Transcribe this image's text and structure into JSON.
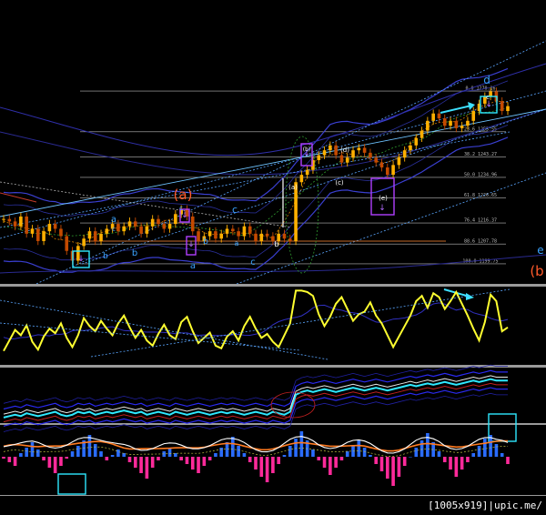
{
  "chart_data": [
    {
      "type": "line",
      "panel": "price",
      "fib_levels": [
        "0.0  1270.16",
        "23.6  1253.55",
        "38.2  1243.27",
        "50.0  1234.96",
        "61.8  1226.65",
        "76.4  1216.37",
        "88.6  1207.78",
        "100.0  1199.75"
      ],
      "wave_labels": [
        {
          "text": "a",
          "color": "#3aa3ff"
        },
        {
          "text": "b",
          "color": "#3aa3ff"
        },
        {
          "text": "c",
          "color": "#3aa3ff"
        },
        {
          "text": "b",
          "color": "#3aa3ff"
        },
        {
          "text": "(a)",
          "color": "#ff5a2a"
        },
        {
          "text": "c",
          "color": "#3aa3ff"
        },
        {
          "text": "a",
          "color": "#3aa3ff"
        },
        {
          "text": "b",
          "color": "#3aa3ff"
        },
        {
          "text": "c",
          "color": "#3aa3ff"
        },
        {
          "text": "a",
          "color": "#3aa3ff"
        },
        {
          "text": "c",
          "color": "#3aa3ff"
        },
        {
          "text": "b",
          "color": "#ffffff"
        },
        {
          "text": "(a)",
          "color": "#ffffff"
        },
        {
          "text": "(b)",
          "color": "#ffffff"
        },
        {
          "text": "(c)",
          "color": "#ffffff"
        },
        {
          "text": "(d)",
          "color": "#ffffff"
        },
        {
          "text": "(e)",
          "color": "#ffffff"
        },
        {
          "text": "c",
          "color": "#ffffff"
        },
        {
          "text": "d",
          "color": "#3aa3ff"
        },
        {
          "text": "e",
          "color": "#3aa3ff"
        },
        {
          "text": "(b",
          "color": "#ff5a2a"
        }
      ],
      "series": [
        {
          "values": [
            1218,
            1217,
            1215,
            1219,
            1212,
            1214,
            1209,
            1213,
            1216,
            1214,
            1211,
            1205,
            1201,
            1207,
            1210,
            1213,
            1209,
            1212,
            1214,
            1216,
            1213,
            1215,
            1217,
            1215,
            1212,
            1215,
            1218,
            1216,
            1214,
            1216,
            1220,
            1222,
            1219,
            1213,
            1209,
            1211,
            1213,
            1210,
            1212,
            1214,
            1213,
            1211,
            1215,
            1212,
            1209,
            1212,
            1211,
            1209,
            1212,
            1210,
            1209,
            1233,
            1236,
            1238,
            1242,
            1244,
            1246,
            1248,
            1244,
            1241,
            1243,
            1246,
            1247,
            1245,
            1243,
            1241,
            1239,
            1236,
            1240,
            1243,
            1246,
            1248,
            1251,
            1254,
            1258,
            1261,
            1259,
            1256,
            1258,
            1255,
            1256,
            1258,
            1262,
            1265,
            1268,
            1270,
            1266,
            1262,
            1264
          ]
        }
      ]
    },
    {
      "type": "line",
      "panel": "oscillator",
      "series": [
        {
          "values": [
            6,
            22,
            38,
            30,
            45,
            20,
            8,
            28,
            40,
            33,
            48,
            26,
            12,
            30,
            56,
            44,
            36,
            52,
            40,
            30,
            48,
            60,
            42,
            26,
            38,
            22,
            14,
            32,
            46,
            30,
            24,
            50,
            58,
            36,
            18,
            26,
            34,
            14,
            10,
            28,
            36,
            22,
            44,
            58,
            40,
            26,
            32,
            20,
            12,
            30,
            48,
            98,
            98,
            96,
            90,
            62,
            44,
            58,
            78,
            88,
            70,
            52,
            62,
            66,
            80,
            60,
            48,
            30,
            12,
            28,
            44,
            60,
            82,
            90,
            72,
            94,
            88,
            70,
            82,
            96,
            78,
            60,
            40,
            22,
            50,
            92,
            82,
            36,
            42
          ]
        }
      ]
    },
    {
      "type": "line",
      "panel": "moving-averages",
      "series": [
        {
          "values": [
            1,
            1.5,
            2,
            1.5,
            2.5,
            2,
            1.5,
            2,
            2.5,
            3,
            2,
            1.5,
            2,
            3,
            2.5,
            3,
            2,
            2.5,
            3,
            2.5,
            3,
            3.5,
            3,
            2.5,
            3,
            2,
            2.5,
            3,
            2.5,
            2,
            3,
            2.5,
            2,
            2.5,
            3,
            2.5,
            2,
            2.5,
            3,
            2.5,
            3,
            2.5,
            2,
            2.5,
            3,
            2.5,
            2,
            3,
            2.5,
            2,
            3,
            9,
            10,
            10.5,
            10,
            10.5,
            11,
            10.5,
            10,
            10.5,
            11,
            11.5,
            11,
            10.5,
            11,
            11.5,
            11,
            10.5,
            11,
            11.5,
            12,
            12.5,
            12,
            12.5,
            13,
            12.5,
            13,
            13.5,
            13,
            12.5,
            13,
            13.5,
            14,
            13.5,
            14,
            14.5,
            14,
            14,
            14
          ]
        }
      ]
    },
    {
      "type": "bar",
      "panel": "histogram-with-signal",
      "values": [
        -1,
        -3,
        -5,
        2,
        5,
        8,
        4,
        -2,
        -6,
        -9,
        -5,
        -1,
        3,
        6,
        9,
        12,
        7,
        3,
        -2,
        1,
        4,
        2,
        -3,
        -6,
        -9,
        -12,
        -6,
        -2,
        3,
        5,
        2,
        -2,
        -4,
        -7,
        -9,
        -5,
        -2,
        2,
        5,
        8,
        11,
        6,
        2,
        -3,
        -7,
        -11,
        -14,
        -9,
        -4,
        1,
        6,
        10,
        14,
        9,
        4,
        -2,
        -6,
        -10,
        -6,
        -2,
        3,
        6,
        9,
        5,
        1,
        -4,
        -8,
        -12,
        -16,
        -11,
        -5,
        0,
        5,
        9,
        13,
        8,
        3,
        -3,
        -7,
        -11,
        -7,
        -3,
        2,
        6,
        10,
        12,
        7,
        2,
        -4
      ]
    }
  ]
}
